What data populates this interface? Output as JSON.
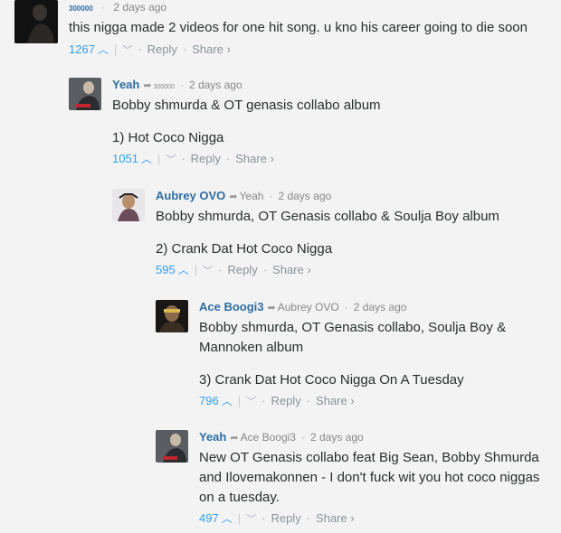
{
  "comments": [
    {
      "author": "300000",
      "parent": "",
      "time": "2 days ago",
      "paragraphs": [
        "this nigga made 2 videos for one hit song. u kno his career going to die soon"
      ],
      "votes": "1267",
      "reply_label": "Reply",
      "share_label": "Share ›"
    },
    {
      "author": "Yeah",
      "parent": "300000",
      "time": "2 days ago",
      "paragraphs": [
        "Bobby shmurda & OT genasis collabo album",
        "1) Hot Coco Nigga"
      ],
      "votes": "1051",
      "reply_label": "Reply",
      "share_label": "Share ›"
    },
    {
      "author": "Aubrey OVO",
      "parent": "Yeah",
      "time": "2 days ago",
      "paragraphs": [
        "Bobby shmurda, OT Genasis collabo & Soulja Boy album",
        "2) Crank Dat Hot Coco Nigga"
      ],
      "votes": "595",
      "reply_label": "Reply",
      "share_label": "Share ›"
    },
    {
      "author": "Ace Boogi3",
      "parent": "Aubrey OVO",
      "time": "2 days ago",
      "paragraphs": [
        "Bobby shmurda, OT Genasis collabo, Soulja Boy & Mannoken album",
        "3) Crank Dat Hot Coco Nigga On A Tuesday"
      ],
      "votes": "796",
      "reply_label": "Reply",
      "share_label": "Share ›"
    },
    {
      "author": "Yeah",
      "parent": "Ace Boogi3",
      "time": "2 days ago",
      "paragraphs": [
        "New OT Genasis collabo feat Big Sean, Bobby Shmurda and Ilovemakonnen - I don't fuck wit you hot coco niggas on a tuesday."
      ],
      "votes": "497",
      "reply_label": "Reply",
      "share_label": "Share ›"
    }
  ]
}
